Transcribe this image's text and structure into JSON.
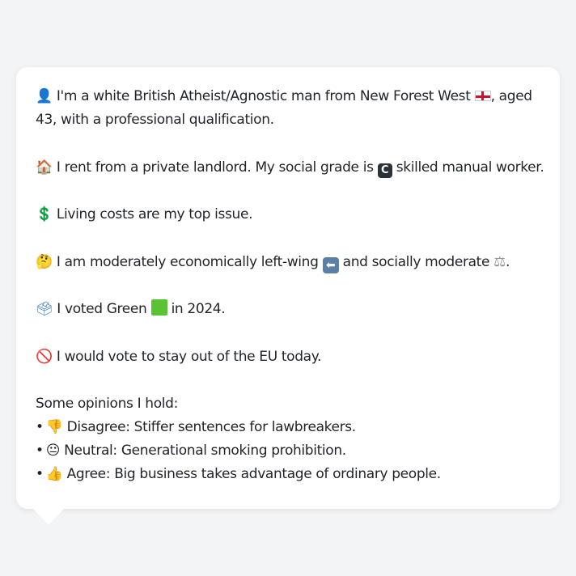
{
  "profile": {
    "line1_text": "I'm a white British Atheist/Agnostic man from New Forest West",
    "line1_tail": ", aged 43, with a professional qualification.",
    "housing_text": "I rent from a private landlord. My social grade is",
    "housing_tail": "skilled manual worker.",
    "grade_letter": "C",
    "issue_text": "Living costs are my top issue.",
    "politics_text": "I am moderately economically left-wing",
    "politics_mid": "and socially moderate",
    "politics_end": ".",
    "vote_text": "I voted Green",
    "vote_tail": "in 2024.",
    "eu_text": "I would vote to stay out of the EU today.",
    "opinions_heading": "Some opinions I hold:",
    "opinions": [
      {
        "bullet": "•",
        "icon": "thumbs-down-icon",
        "text": "Disagree: Stiffer sentences for lawbreakers."
      },
      {
        "bullet": "•",
        "icon": "neutral-face-icon",
        "text": "Neutral: Generational smoking prohibition."
      },
      {
        "bullet": "•",
        "icon": "thumbs-up-icon",
        "text": "Agree: Big business takes advantage of ordinary people."
      }
    ]
  },
  "icons": {
    "person": "👤",
    "house": "🏠",
    "dollar": "💲",
    "thinking": "🤔",
    "ballot": "🗳",
    "no_entry": "🚫",
    "arrow_left": "⬅",
    "scales": "⚖",
    "thumbs_down": "👎",
    "neutral": "😐",
    "thumbs_up": "👍"
  },
  "colors": {
    "page_bg": "#f3f4f6",
    "bubble_bg": "#ffffff",
    "text": "#1f2328",
    "flag_red": "#d0102a",
    "green_square": "#5bc236"
  }
}
